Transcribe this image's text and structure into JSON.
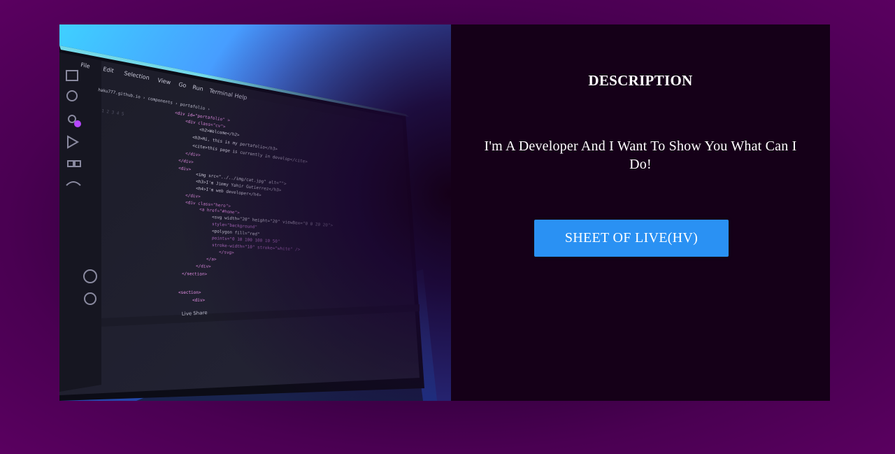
{
  "card": {
    "heading": "DESCRIPTION",
    "tagline": "I'm A Developer And I Want To Show You What Can I Do!",
    "button_label": "SHEET OF LIVE(HV)"
  },
  "hero_image": {
    "menu": [
      "File",
      "Edit",
      "Selection",
      "View",
      "Go",
      "Run",
      "Terminal",
      "Help"
    ],
    "breadcrumb": "haku777.github.io > components > portafolio >",
    "code_lines": [
      "<div id=\"portafolio\" >",
      "<div class=\"cv\">",
      "<h2>Welcome</h2>",
      "<h3>Hi, this is my portafolio</h3>",
      "<cite>this page is currently in develop</cite>",
      "</div>",
      "</div>",
      "<div>",
      "<img src=\"../../img/cat.jpg\" alt=\"\">",
      "<h3>I'm Jimmy Yahir Gutierrez</h3>",
      "<h4>I'm web developer</h4>",
      "</div>",
      "<div class=\"hero\">",
      "<a href=\"#home\">",
      "<svg width=\"20\" height=\"20\" viewBox=\"0 0 20 20\">",
      "style=\"background\"",
      "<polygon fill=\"red\"",
      "points=\"0 10 100 100 10 50\"",
      "stroke-width=\"10\" stroke=\"white\" />",
      "</svg>",
      "</a>",
      "</div>",
      "</section>",
      "",
      "<section>",
      "<div>"
    ],
    "status_bar": "Live Share",
    "colors": {
      "screen_bg": "#1e1e2a",
      "glow": "#35c8ff",
      "accent": "#2a91f3"
    }
  },
  "colors": {
    "page_bg": "#2a0036",
    "card_bg": "#150018",
    "button_bg": "#2a91f3",
    "text": "#ffffff"
  }
}
